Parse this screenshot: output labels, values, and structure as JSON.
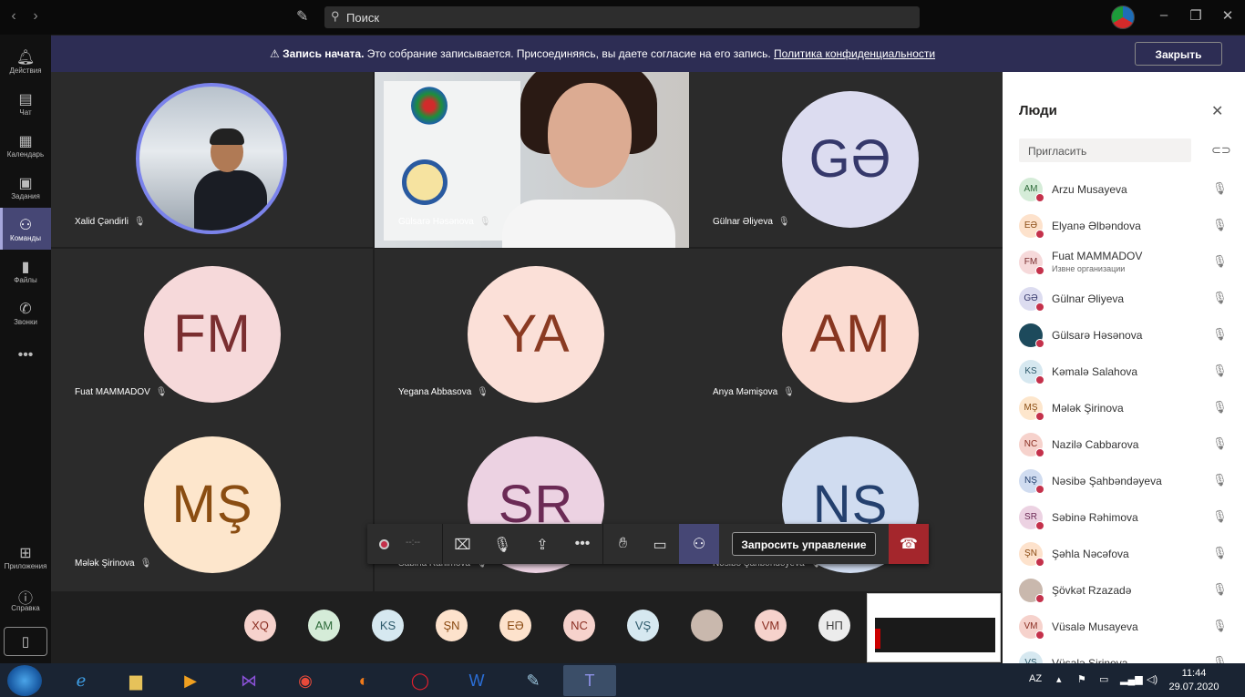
{
  "window": {
    "search_placeholder": "Поиск"
  },
  "rail": {
    "items": [
      {
        "label": "Действия",
        "icon": "bell-icon"
      },
      {
        "label": "Чат",
        "icon": "chat-icon"
      },
      {
        "label": "Календарь",
        "icon": "calendar-icon"
      },
      {
        "label": "Задания",
        "icon": "assignments-icon"
      },
      {
        "label": "Команды",
        "icon": "teams-icon"
      },
      {
        "label": "Файлы",
        "icon": "files-icon"
      },
      {
        "label": "Звонки",
        "icon": "calls-icon"
      }
    ],
    "more": "•••",
    "apps_label": "Приложения",
    "help_label": "Справка"
  },
  "banner": {
    "bold": "Запись начата.",
    "text": " Это собрание записывается. Присоединяясь, вы даете согласие на его запись. ",
    "link": "Политика конфиденциальности",
    "close": "Закрыть"
  },
  "tiles": [
    {
      "name": "Xalid Çəndirli",
      "type": "photo"
    },
    {
      "name": "Gülsarə Həsənova",
      "type": "video"
    },
    {
      "name": "Gülnar Əliyeva",
      "initials": "GƏ",
      "bg": "#dcdcf0",
      "fg": "#35386b"
    },
    {
      "name": "Fuat MAMMADOV",
      "initials": "FM",
      "bg": "#f6d9da",
      "fg": "#7a2e30"
    },
    {
      "name": "Yegana Abbasova",
      "initials": "YA",
      "bg": "#fbe0d8",
      "fg": "#8a3a22"
    },
    {
      "name": "Anya Məmişova",
      "initials": "AM",
      "bg": "#fbdcd2",
      "fg": "#873620"
    },
    {
      "name": "Mələk Şirinova",
      "initials": "MŞ",
      "bg": "#fde6cc",
      "fg": "#8a4d12"
    },
    {
      "name": "Sabina Rahimova",
      "initials": "SR",
      "bg": "#ecd2e2",
      "fg": "#6b2a55"
    },
    {
      "name": "Nəsibə Şahbəndəyeva",
      "initials": "NŞ",
      "bg": "#d0dcf0",
      "fg": "#24406e"
    }
  ],
  "controls": {
    "timer": "--:--",
    "request_control": "Запросить управление"
  },
  "strip": [
    {
      "initials": "XQ",
      "bg": "#f6d2cc",
      "fg": "#8a2e22"
    },
    {
      "initials": "AM",
      "bg": "#d5ecd8",
      "fg": "#2e6b3a"
    },
    {
      "initials": "KS",
      "bg": "#d6e8f0",
      "fg": "#2e5a6b"
    },
    {
      "initials": "ŞN",
      "bg": "#fde2cc",
      "fg": "#8a4a12"
    },
    {
      "initials": "EƏ",
      "bg": "#fde2cc",
      "fg": "#8a4a12"
    },
    {
      "initials": "NC",
      "bg": "#f6d2cc",
      "fg": "#8a2e22"
    },
    {
      "initials": "VŞ",
      "bg": "#d6e8f0",
      "fg": "#2e5a6b"
    },
    {
      "initials": "",
      "bg": "#c9b8ad",
      "fg": "#333"
    },
    {
      "initials": "VM",
      "bg": "#f6d2cc",
      "fg": "#8a2e22"
    },
    {
      "initials": "НП",
      "bg": "#ececec",
      "fg": "#444"
    }
  ],
  "people": {
    "title": "Люди",
    "invite_placeholder": "Пригласить",
    "list": [
      {
        "initials": "AM",
        "name": "Arzu Musayeva",
        "bg": "#d5ecd8",
        "fg": "#2e6b3a"
      },
      {
        "initials": "EƏ",
        "name": "Elyanə Əlbəndova",
        "bg": "#fde2cc",
        "fg": "#8a4a12"
      },
      {
        "initials": "FM",
        "name": "Fuat MAMMADOV",
        "sub": "Извне организации",
        "bg": "#f6d9da",
        "fg": "#7a2e30"
      },
      {
        "initials": "GƏ",
        "name": "Gülnar Əliyeva",
        "bg": "#dcdcf0",
        "fg": "#35386b"
      },
      {
        "initials": "",
        "name": "Gülsarə Həsənova",
        "bg": "#1d4a5c",
        "fg": "#fff"
      },
      {
        "initials": "KS",
        "name": "Kəmalə Salahova",
        "bg": "#d6e8f0",
        "fg": "#2e5a6b"
      },
      {
        "initials": "MŞ",
        "name": "Mələk Şirinova",
        "bg": "#fde6cc",
        "fg": "#8a4d12"
      },
      {
        "initials": "NC",
        "name": "Nazilə Cabbarova",
        "bg": "#f6d2cc",
        "fg": "#8a2e22"
      },
      {
        "initials": "NŞ",
        "name": "Nəsibə Şahbəndəyeva",
        "bg": "#d0dcf0",
        "fg": "#24406e"
      },
      {
        "initials": "SR",
        "name": "Səbinə Rəhimova",
        "bg": "#ecd2e2",
        "fg": "#6b2a55"
      },
      {
        "initials": "ŞN",
        "name": "Şəhla Nəcəfova",
        "bg": "#fde2cc",
        "fg": "#8a4a12"
      },
      {
        "initials": "",
        "name": "Şövkət Rzazadə",
        "bg": "#c9b8ad",
        "fg": "#333"
      },
      {
        "initials": "VM",
        "name": "Vüsalə Musayeva",
        "bg": "#f6d2cc",
        "fg": "#8a2e22"
      },
      {
        "initials": "VŞ",
        "name": "Vüsalə Şirinova",
        "bg": "#d6e8f0",
        "fg": "#2e5a6b"
      }
    ]
  },
  "taskbar": {
    "lang": "AZ",
    "time": "11:44",
    "date": "29.07.2020"
  }
}
